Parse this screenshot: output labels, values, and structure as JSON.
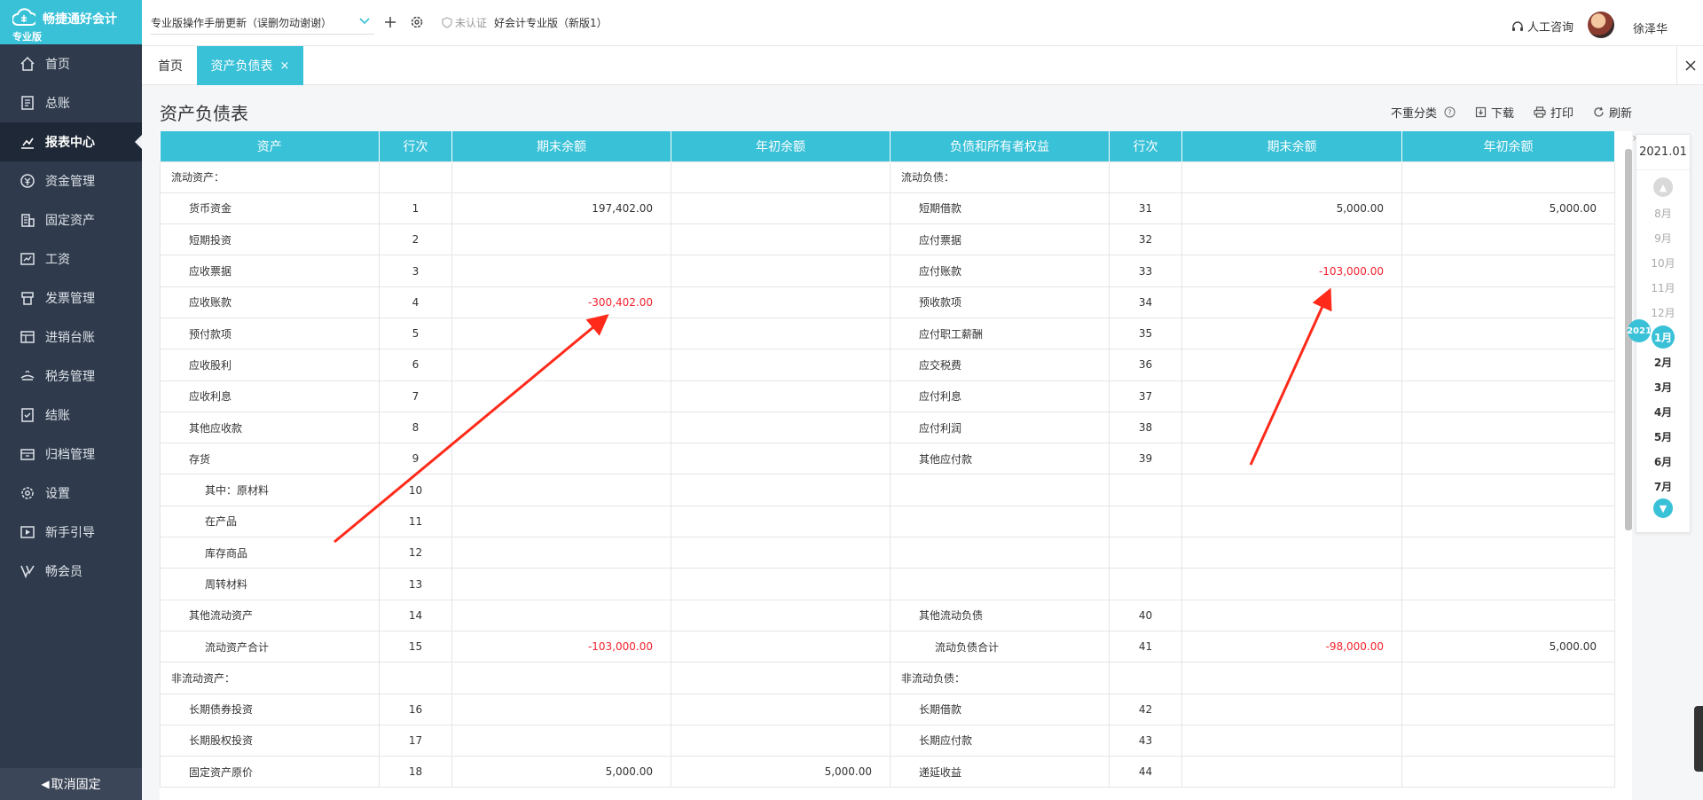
{
  "app": {
    "brand": "畅捷通好会计",
    "edition": "专业版"
  },
  "sidebar": {
    "items": [
      {
        "label": "首页",
        "icon": "home-icon"
      },
      {
        "label": "总账",
        "icon": "ledger-icon"
      },
      {
        "label": "报表中心",
        "icon": "chart-icon",
        "active": true
      },
      {
        "label": "资金管理",
        "icon": "money-icon"
      },
      {
        "label": "固定资产",
        "icon": "building-icon"
      },
      {
        "label": "工资",
        "icon": "salary-icon"
      },
      {
        "label": "发票管理",
        "icon": "invoice-icon"
      },
      {
        "label": "进销台账",
        "icon": "inventory-icon"
      },
      {
        "label": "税务管理",
        "icon": "tax-icon"
      },
      {
        "label": "结账",
        "icon": "checkout-icon"
      },
      {
        "label": "归档管理",
        "icon": "archive-icon"
      },
      {
        "label": "设置",
        "icon": "gear-icon"
      },
      {
        "label": "新手引导",
        "icon": "play-icon"
      },
      {
        "label": "畅会员",
        "icon": "vip-icon"
      }
    ],
    "unpin_label": "取消固定"
  },
  "topbar": {
    "doc_select": "专业版操作手册更新（误删勿动谢谢）",
    "cert_label": "未认证",
    "version_label": "好会计专业版（新版1）",
    "support_label": "人工咨询",
    "user_name": "徐泽华"
  },
  "tabs": {
    "home": "首页",
    "active": "资产负债表",
    "close": "×"
  },
  "page": {
    "title": "资产负债表",
    "toolbar": {
      "no_classify": "不重分类",
      "download": "下载",
      "print": "打印",
      "refresh": "刷新"
    }
  },
  "table": {
    "headers": [
      "资产",
      "行次",
      "期末余额",
      "年初余额",
      "负债和所有者权益",
      "行次",
      "期末余额",
      "年初余额"
    ],
    "rows": [
      {
        "a": "流动资产：",
        "ai": 0,
        "an": "",
        "ae": "",
        "ab": "",
        "l": "流动负债：",
        "li": 0,
        "ln": "",
        "le": "",
        "lb": ""
      },
      {
        "a": "货币资金",
        "ai": 1,
        "an": "1",
        "ae": "197,402.00",
        "ab": "",
        "l": "短期借款",
        "li": 1,
        "ln": "31",
        "le": "5,000.00",
        "lb": "5,000.00"
      },
      {
        "a": "短期投资",
        "ai": 1,
        "an": "2",
        "ae": "",
        "ab": "",
        "l": "应付票据",
        "li": 1,
        "ln": "32",
        "le": "",
        "lb": ""
      },
      {
        "a": "应收票据",
        "ai": 1,
        "an": "3",
        "ae": "",
        "ab": "",
        "l": "应付账款",
        "li": 1,
        "ln": "33",
        "le": "-103,000.00",
        "lb": ""
      },
      {
        "a": "应收账款",
        "ai": 1,
        "an": "4",
        "ae": "-300,402.00",
        "ab": "",
        "l": "预收款项",
        "li": 1,
        "ln": "34",
        "le": "",
        "lb": ""
      },
      {
        "a": "预付款项",
        "ai": 1,
        "an": "5",
        "ae": "",
        "ab": "",
        "l": "应付职工薪酬",
        "li": 1,
        "ln": "35",
        "le": "",
        "lb": ""
      },
      {
        "a": "应收股利",
        "ai": 1,
        "an": "6",
        "ae": "",
        "ab": "",
        "l": "应交税费",
        "li": 1,
        "ln": "36",
        "le": "",
        "lb": ""
      },
      {
        "a": "应收利息",
        "ai": 1,
        "an": "7",
        "ae": "",
        "ab": "",
        "l": "应付利息",
        "li": 1,
        "ln": "37",
        "le": "",
        "lb": ""
      },
      {
        "a": "其他应收款",
        "ai": 1,
        "an": "8",
        "ae": "",
        "ab": "",
        "l": "应付利润",
        "li": 1,
        "ln": "38",
        "le": "",
        "lb": ""
      },
      {
        "a": "存货",
        "ai": 1,
        "an": "9",
        "ae": "",
        "ab": "",
        "l": "其他应付款",
        "li": 1,
        "ln": "39",
        "le": "",
        "lb": ""
      },
      {
        "a": "其中：原材料",
        "ai": 2,
        "an": "10",
        "ae": "",
        "ab": "",
        "l": "",
        "li": 1,
        "ln": "",
        "le": "",
        "lb": ""
      },
      {
        "a": "在产品",
        "ai": 2,
        "an": "11",
        "ae": "",
        "ab": "",
        "l": "",
        "li": 1,
        "ln": "",
        "le": "",
        "lb": ""
      },
      {
        "a": "库存商品",
        "ai": 2,
        "an": "12",
        "ae": "",
        "ab": "",
        "l": "",
        "li": 1,
        "ln": "",
        "le": "",
        "lb": ""
      },
      {
        "a": "周转材料",
        "ai": 2,
        "an": "13",
        "ae": "",
        "ab": "",
        "l": "",
        "li": 1,
        "ln": "",
        "le": "",
        "lb": ""
      },
      {
        "a": "其他流动资产",
        "ai": 1,
        "an": "14",
        "ae": "",
        "ab": "",
        "l": "其他流动负债",
        "li": 1,
        "ln": "40",
        "le": "",
        "lb": ""
      },
      {
        "a": "流动资产合计",
        "ai": 2,
        "an": "15",
        "ae": "-103,000.00",
        "ab": "",
        "l": "流动负债合计",
        "li": 2,
        "ln": "41",
        "le": "-98,000.00",
        "lb": "5,000.00"
      },
      {
        "a": "非流动资产：",
        "ai": 0,
        "an": "",
        "ae": "",
        "ab": "",
        "l": "非流动负债：",
        "li": 0,
        "ln": "",
        "le": "",
        "lb": ""
      },
      {
        "a": "长期债券投资",
        "ai": 1,
        "an": "16",
        "ae": "",
        "ab": "",
        "l": "长期借款",
        "li": 1,
        "ln": "42",
        "le": "",
        "lb": ""
      },
      {
        "a": "长期股权投资",
        "ai": 1,
        "an": "17",
        "ae": "",
        "ab": "",
        "l": "长期应付款",
        "li": 1,
        "ln": "43",
        "le": "",
        "lb": ""
      },
      {
        "a": "固定资产原价",
        "ai": 1,
        "an": "18",
        "ae": "5,000.00",
        "ab": "5,000.00",
        "l": "递延收益",
        "li": 1,
        "ln": "44",
        "le": "",
        "lb": ""
      }
    ]
  },
  "period": {
    "current": "2021.01",
    "year_badge": "2021",
    "months": [
      {
        "label": "8月",
        "state": "past"
      },
      {
        "label": "9月",
        "state": "past"
      },
      {
        "label": "10月",
        "state": "past"
      },
      {
        "label": "11月",
        "state": "past"
      },
      {
        "label": "12月",
        "state": "past"
      },
      {
        "label": "1月",
        "state": "sel"
      },
      {
        "label": "2月",
        "state": "fut"
      },
      {
        "label": "3月",
        "state": "fut"
      },
      {
        "label": "4月",
        "state": "fut"
      },
      {
        "label": "5月",
        "state": "fut"
      },
      {
        "label": "6月",
        "state": "fut"
      },
      {
        "label": "7月",
        "state": "fut"
      }
    ]
  },
  "colors": {
    "accent": "#39c1d8",
    "sidebar": "#2f3b4c",
    "negative": "#f5222d",
    "annotation": "#ff2a1a"
  }
}
